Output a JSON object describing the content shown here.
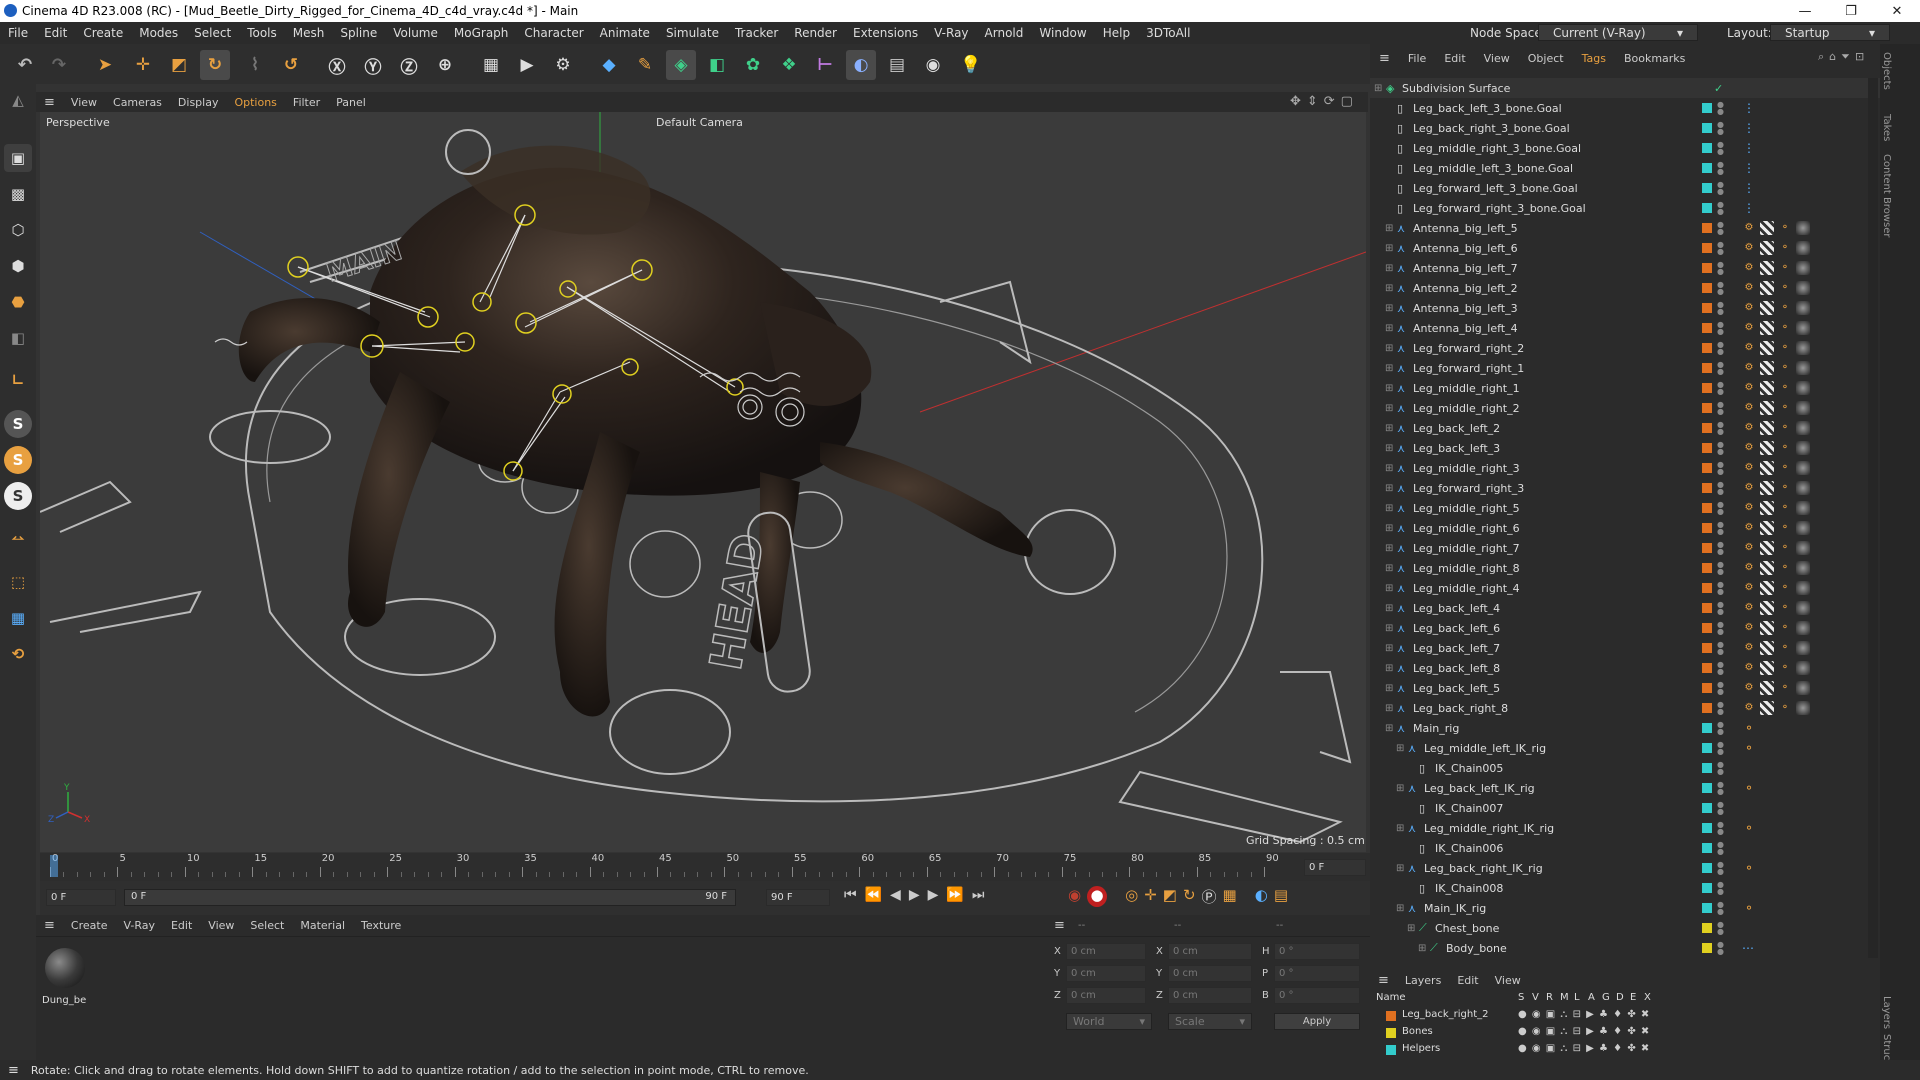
{
  "window": {
    "title": "Cinema 4D R23.008 (RC) - [Mud_Beetle_Dirty_Rigged_for_Cinema_4D_c4d_vray.c4d *] - Main",
    "min": "—",
    "max": "❐",
    "close": "✕"
  },
  "menu": [
    "File",
    "Edit",
    "Create",
    "Modes",
    "Select",
    "Tools",
    "Mesh",
    "Spline",
    "Volume",
    "MoGraph",
    "Character",
    "Animate",
    "Simulate",
    "Tracker",
    "Render",
    "Extensions",
    "V-Ray",
    "Arnold",
    "Window",
    "Help",
    "3DToAll"
  ],
  "nodespace": {
    "label": "Node Space:",
    "value": "Current (V-Ray)"
  },
  "layout": {
    "label": "Layout:",
    "value": "Startup"
  },
  "viewport": {
    "menu": [
      "View",
      "Cameras",
      "Display",
      "Options",
      "Filter",
      "Panel"
    ],
    "mode": "Perspective",
    "camera": "Default Camera",
    "grid": "Grid Spacing : 0.5 cm",
    "head_text": "HEAD",
    "main_text": "MAIN"
  },
  "timeline": {
    "ticks": [
      "0",
      "5",
      "10",
      "15",
      "20",
      "25",
      "30",
      "35",
      "40",
      "45",
      "50",
      "55",
      "60",
      "65",
      "70",
      "75",
      "80",
      "85",
      "90"
    ],
    "current": "0 F",
    "start": "0 F",
    "range_start": "0 F",
    "range_end": "90 F",
    "end": "90 F"
  },
  "materials": {
    "menu": [
      "Create",
      "V-Ray",
      "Edit",
      "View",
      "Select",
      "Material",
      "Texture"
    ],
    "items": [
      {
        "name": "Dung_be"
      }
    ]
  },
  "coords": {
    "labels": [
      "X",
      "Y",
      "Z"
    ],
    "labels2": [
      "X",
      "Y",
      "Z"
    ],
    "labels3": [
      "H",
      "P",
      "B"
    ],
    "pos": [
      "0 cm",
      "0 cm",
      "0 cm"
    ],
    "size": [
      "0 cm",
      "0 cm",
      "0 cm"
    ],
    "rot": [
      "0 °",
      "0 °",
      "0 °"
    ],
    "top1": "--",
    "top2": "--",
    "top3": "--",
    "world": "World",
    "scale": "Scale",
    "apply": "Apply"
  },
  "objects": {
    "menu": [
      "File",
      "Edit",
      "View",
      "Object",
      "Tags",
      "Bookmarks"
    ],
    "rows": [
      {
        "name": "Subdivision Surface",
        "indent": 0,
        "type": "sds",
        "color": "#555"
      },
      {
        "name": "Leg_back_left_3_bone.Goal",
        "indent": 1,
        "type": "null",
        "color": "#3cc"
      },
      {
        "name": "Leg_back_right_3_bone.Goal",
        "indent": 1,
        "type": "null",
        "color": "#3cc"
      },
      {
        "name": "Leg_middle_right_3_bone.Goal",
        "indent": 1,
        "type": "null",
        "color": "#3cc"
      },
      {
        "name": "Leg_middle_left_3_bone.Goal",
        "indent": 1,
        "type": "null",
        "color": "#3cc"
      },
      {
        "name": "Leg_forward_left_3_bone.Goal",
        "indent": 1,
        "type": "null",
        "color": "#3cc"
      },
      {
        "name": "Leg_forward_right_3_bone.Goal",
        "indent": 1,
        "type": "null",
        "color": "#3cc"
      },
      {
        "name": "Antenna_big_left_5",
        "indent": 1,
        "type": "joint",
        "color": "#e07020"
      },
      {
        "name": "Antenna_big_left_6",
        "indent": 1,
        "type": "joint",
        "color": "#e07020"
      },
      {
        "name": "Antenna_big_left_7",
        "indent": 1,
        "type": "joint",
        "color": "#e07020"
      },
      {
        "name": "Antenna_big_left_2",
        "indent": 1,
        "type": "joint",
        "color": "#e07020"
      },
      {
        "name": "Antenna_big_left_3",
        "indent": 1,
        "type": "joint",
        "color": "#e07020"
      },
      {
        "name": "Antenna_big_left_4",
        "indent": 1,
        "type": "joint",
        "color": "#e07020"
      },
      {
        "name": "Leg_forward_right_2",
        "indent": 1,
        "type": "joint",
        "color": "#e07020"
      },
      {
        "name": "Leg_forward_right_1",
        "indent": 1,
        "type": "joint",
        "color": "#e07020"
      },
      {
        "name": "Leg_middle_right_1",
        "indent": 1,
        "type": "joint",
        "color": "#e07020"
      },
      {
        "name": "Leg_middle_right_2",
        "indent": 1,
        "type": "joint",
        "color": "#e07020"
      },
      {
        "name": "Leg_back_left_2",
        "indent": 1,
        "type": "joint",
        "color": "#e07020"
      },
      {
        "name": "Leg_back_left_3",
        "indent": 1,
        "type": "joint",
        "color": "#e07020"
      },
      {
        "name": "Leg_middle_right_3",
        "indent": 1,
        "type": "joint",
        "color": "#e07020"
      },
      {
        "name": "Leg_forward_right_3",
        "indent": 1,
        "type": "joint",
        "color": "#e07020"
      },
      {
        "name": "Leg_middle_right_5",
        "indent": 1,
        "type": "joint",
        "color": "#e07020"
      },
      {
        "name": "Leg_middle_right_6",
        "indent": 1,
        "type": "joint",
        "color": "#e07020"
      },
      {
        "name": "Leg_middle_right_7",
        "indent": 1,
        "type": "joint",
        "color": "#e07020"
      },
      {
        "name": "Leg_middle_right_8",
        "indent": 1,
        "type": "joint",
        "color": "#e07020"
      },
      {
        "name": "Leg_middle_right_4",
        "indent": 1,
        "type": "joint",
        "color": "#e07020"
      },
      {
        "name": "Leg_back_left_4",
        "indent": 1,
        "type": "joint",
        "color": "#e07020"
      },
      {
        "name": "Leg_back_left_6",
        "indent": 1,
        "type": "joint",
        "color": "#e07020"
      },
      {
        "name": "Leg_back_left_7",
        "indent": 1,
        "type": "joint",
        "color": "#e07020"
      },
      {
        "name": "Leg_back_left_8",
        "indent": 1,
        "type": "joint",
        "color": "#e07020"
      },
      {
        "name": "Leg_back_left_5",
        "indent": 1,
        "type": "joint",
        "color": "#e07020"
      },
      {
        "name": "Leg_back_right_8",
        "indent": 1,
        "type": "joint",
        "color": "#e07020"
      },
      {
        "name": "Main_rig",
        "indent": 1,
        "type": "joint",
        "color": "#3cc"
      },
      {
        "name": "Leg_middle_left_IK_rig",
        "indent": 2,
        "type": "joint",
        "color": "#3cc"
      },
      {
        "name": "IK_Chain005",
        "indent": 3,
        "type": "null",
        "color": "#3cc"
      },
      {
        "name": "Leg_back_left_IK_rig",
        "indent": 2,
        "type": "joint",
        "color": "#3cc"
      },
      {
        "name": "IK_Chain007",
        "indent": 3,
        "type": "null",
        "color": "#3cc"
      },
      {
        "name": "Leg_middle_right_IK_rig",
        "indent": 2,
        "type": "joint",
        "color": "#3cc"
      },
      {
        "name": "IK_Chain006",
        "indent": 3,
        "type": "null",
        "color": "#3cc"
      },
      {
        "name": "Leg_back_right_IK_rig",
        "indent": 2,
        "type": "joint",
        "color": "#3cc"
      },
      {
        "name": "IK_Chain008",
        "indent": 3,
        "type": "null",
        "color": "#3cc"
      },
      {
        "name": "Main_IK_rig",
        "indent": 2,
        "type": "joint",
        "color": "#3cc"
      },
      {
        "name": "Chest_bone",
        "indent": 3,
        "type": "bone",
        "color": "#e0d020"
      },
      {
        "name": "Body_bone",
        "indent": 4,
        "type": "bone",
        "color": "#e0d020"
      }
    ]
  },
  "layers": {
    "menu": [
      "Layers",
      "Edit",
      "View"
    ],
    "cols": [
      "Name",
      "S",
      "V",
      "R",
      "M",
      "L",
      "A",
      "G",
      "D",
      "E",
      "X"
    ],
    "rows": [
      {
        "name": "Leg_back_right_2",
        "color": "#e07020"
      },
      {
        "name": "Bones",
        "color": "#e0d020"
      },
      {
        "name": "Helpers",
        "color": "#3cc"
      }
    ]
  },
  "status": "Rotate: Click and drag to rotate elements. Hold down SHIFT to add to quantize rotation / add to the selection in point mode, CTRL to remove.",
  "side_tabs": [
    "Objects",
    "Takes",
    "Content Browser",
    "Layers",
    "Struc"
  ]
}
